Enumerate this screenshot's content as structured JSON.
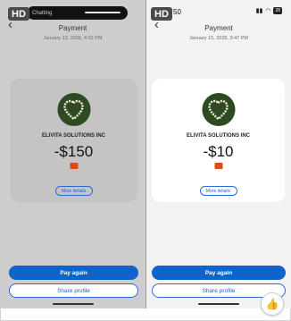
{
  "left": {
    "hd_label": "HD",
    "notification_text": "Chatting",
    "back_glyph": "‹",
    "title": "Payment",
    "date": "January 13, 2026, 4:02 PM",
    "merchant": "ELIVITA SOLUTIONS INC",
    "amount": "-$150",
    "more_details": "More details",
    "pay_again": "Pay again",
    "share_profile": "Share profile"
  },
  "right": {
    "hd_label": "HD",
    "time": "50",
    "battery": "28",
    "back_glyph": "‹",
    "title": "Payment",
    "date": "January 15, 2026, 3:47 PM",
    "merchant": "ELIVITA SOLUTIONS INC",
    "amount": "-$10",
    "more_details": "More details",
    "pay_again": "Pay again",
    "share_profile": "Share profile"
  },
  "icons": {
    "logo": "wreath-heart-icon",
    "flag": "flag-icon",
    "thumb": "thumbs-up-icon",
    "back": "chevron-left-icon"
  },
  "colors": {
    "primary": "#0f63c9",
    "logo_bg": "#2f4a22"
  }
}
